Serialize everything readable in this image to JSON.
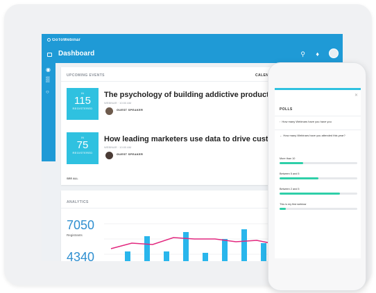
{
  "app": {
    "brand": "GoToWebinar",
    "page_title": "Dashboard"
  },
  "colors": {
    "primary": "#1f9ad6",
    "tile": "#2fc1e0",
    "poll_bar": "#2ecfa8",
    "analytics_bar": "#29b6ec",
    "analytics_line": "#e2277e"
  },
  "events": {
    "title": "UPCOMING EVENTS",
    "calendar_link": "CALENDAR",
    "see_all": "SEE ALL",
    "items": [
      {
        "count": "115",
        "count_label": "REGISTERED",
        "count_prefix": "IN",
        "title": "The psychology of building addictive products.",
        "meta": "WEBINAR · 10:00 AM",
        "speaker_role": "GUEST SPEAKER",
        "speaker_name": ""
      },
      {
        "count": "75",
        "count_label": "REGISTERED",
        "count_prefix": "IN",
        "title": "How leading marketers use data to drive customer",
        "meta": "WEBINAR · 10:00 AM",
        "speaker_role": "GUEST SPEAKER",
        "speaker_name": ""
      }
    ]
  },
  "analytics": {
    "title": "ANALYTICS",
    "stats": [
      {
        "value": "7050",
        "label": "Registrants"
      },
      {
        "value": "4340",
        "label": ""
      }
    ]
  },
  "polls": {
    "title": "POLLS",
    "count": "",
    "questions": [
      {
        "text": "How many Webinars have you have you"
      },
      {
        "text": "How many Webinars have you attended this year?",
        "sub": ""
      }
    ],
    "options": [
      {
        "label": "More than 10",
        "percent": 0.3,
        "pct_text": ""
      },
      {
        "label": "Between 5 and 5",
        "percent": 0.5,
        "pct_text": ""
      },
      {
        "label": "Between 2 and 5",
        "percent": 0.78,
        "pct_text": ""
      },
      {
        "label": "This is my first webinar",
        "percent": 0.08,
        "pct_text": ""
      }
    ]
  }
}
